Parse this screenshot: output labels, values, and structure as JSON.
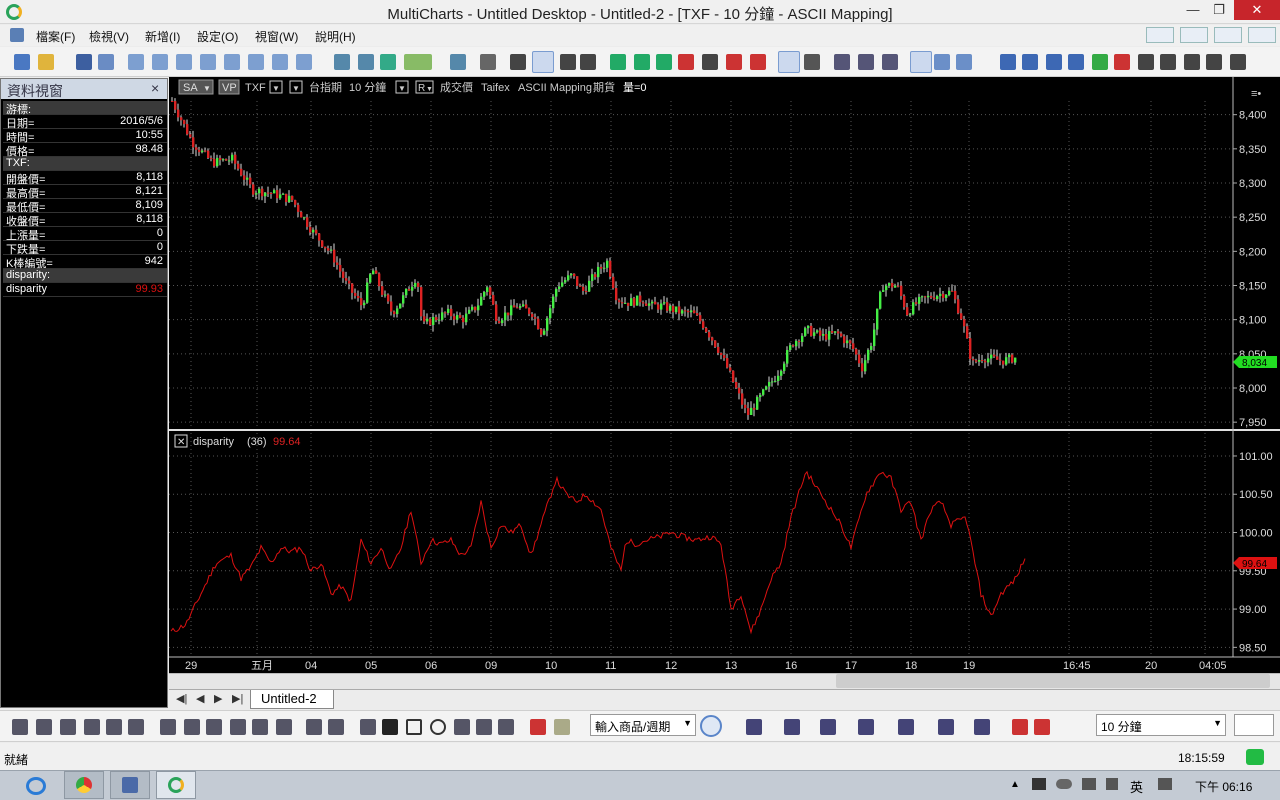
{
  "window": {
    "title": "MultiCharts - Untitled Desktop - Untitled-2 - [TXF - 10 分鐘 - ASCII Mapping]"
  },
  "menu": [
    "檔案(F)",
    "檢視(V)",
    "新增(I)",
    "設定(O)",
    "視窗(W)",
    "說明(H)"
  ],
  "dataview": {
    "title": "資料視窗",
    "rows": [
      {
        "k": "游標:",
        "v": "",
        "section": true
      },
      {
        "k": "日期=",
        "v": "2016/5/6"
      },
      {
        "k": "時間=",
        "v": "10:55"
      },
      {
        "k": "價格=",
        "v": "98.48"
      },
      {
        "k": "TXF:",
        "v": "",
        "section": true
      },
      {
        "k": "開盤價=",
        "v": "8,118"
      },
      {
        "k": "最高價=",
        "v": "8,121"
      },
      {
        "k": "最低價=",
        "v": "8,109"
      },
      {
        "k": "收盤價=",
        "v": "8,118"
      },
      {
        "k": "上漲量=",
        "v": "0"
      },
      {
        "k": "下跌量=",
        "v": "0"
      },
      {
        "k": "K棒編號=",
        "v": "942"
      },
      {
        "k": "disparity:",
        "v": "",
        "section": true
      },
      {
        "k": "disparity",
        "v": "99.93",
        "red": true
      }
    ]
  },
  "chart": {
    "header": {
      "badges": [
        "SA",
        "VP"
      ],
      "symbol": "TXF",
      "exchange": "台指期",
      "interval": "10 分鐘",
      "badge_r": "R",
      "field": "成交價",
      "source": "Taifex",
      "mapping": "ASCII Mapping",
      "category": "期貨",
      "volume": "量=0"
    },
    "indicator": {
      "name": "disparity",
      "param": "(36)",
      "value": "99.64"
    },
    "price_last": "8,034",
    "disp_last": "99.64"
  },
  "chart_data": [
    {
      "type": "candlestick",
      "yaxis": [
        "8,400",
        "8,350",
        "8,300",
        "8,250",
        "8,200",
        "8,150",
        "8,100",
        "8,050",
        "8,000",
        "7,950"
      ],
      "ylim": [
        7940,
        8420
      ],
      "path": [
        [
          0,
          8420
        ],
        [
          20,
          8360
        ],
        [
          40,
          8330
        ],
        [
          60,
          8335
        ],
        [
          80,
          8290
        ],
        [
          100,
          8285
        ],
        [
          120,
          8275
        ],
        [
          140,
          8230
        ],
        [
          160,
          8195
        ],
        [
          175,
          8150
        ],
        [
          190,
          8120
        ],
        [
          200,
          8175
        ],
        [
          210,
          8140
        ],
        [
          220,
          8110
        ],
        [
          230,
          8130
        ],
        [
          245,
          8165
        ],
        [
          250,
          8090
        ],
        [
          260,
          8100
        ],
        [
          275,
          8110
        ],
        [
          290,
          8100
        ],
        [
          305,
          8120
        ],
        [
          315,
          8150
        ],
        [
          325,
          8100
        ],
        [
          335,
          8110
        ],
        [
          345,
          8120
        ],
        [
          360,
          8110
        ],
        [
          370,
          8080
        ],
        [
          385,
          8150
        ],
        [
          400,
          8165
        ],
        [
          410,
          8140
        ],
        [
          425,
          8170
        ],
        [
          435,
          8185
        ],
        [
          445,
          8130
        ],
        [
          455,
          8125
        ],
        [
          470,
          8130
        ],
        [
          480,
          8120
        ],
        [
          490,
          8120
        ],
        [
          500,
          8115
        ],
        [
          510,
          8110
        ],
        [
          520,
          8110
        ],
        [
          530,
          8095
        ],
        [
          545,
          8060
        ],
        [
          555,
          8030
        ],
        [
          575,
          7960
        ],
        [
          590,
          7990
        ],
        [
          605,
          8020
        ],
        [
          620,
          8065
        ],
        [
          635,
          8085
        ],
        [
          650,
          8075
        ],
        [
          665,
          8080
        ],
        [
          680,
          8060
        ],
        [
          690,
          8030
        ],
        [
          700,
          8070
        ],
        [
          710,
          8150
        ],
        [
          725,
          8150
        ],
        [
          735,
          8110
        ],
        [
          745,
          8125
        ],
        [
          760,
          8135
        ],
        [
          775,
          8140
        ],
        [
          780,
          8140
        ],
        [
          790,
          8100
        ],
        [
          800,
          8035
        ],
        [
          810,
          8045
        ],
        [
          830,
          8040
        ],
        [
          845,
          8045
        ]
      ]
    },
    {
      "type": "line",
      "series_name": "disparity",
      "yaxis": [
        "101.00",
        "100.50",
        "100.00",
        "99.50",
        "99.00",
        "98.50"
      ],
      "ylim": [
        98.4,
        101.3
      ],
      "path": [
        [
          0,
          98.7
        ],
        [
          15,
          98.8
        ],
        [
          30,
          99.2
        ],
        [
          45,
          99.6
        ],
        [
          60,
          99.7
        ],
        [
          70,
          99.4
        ],
        [
          80,
          99.55
        ],
        [
          90,
          99.8
        ],
        [
          100,
          99.6
        ],
        [
          110,
          99.8
        ],
        [
          120,
          99.75
        ],
        [
          130,
          99.8
        ],
        [
          140,
          99.5
        ],
        [
          150,
          99.6
        ],
        [
          160,
          99.2
        ],
        [
          170,
          99.3
        ],
        [
          180,
          99.1
        ],
        [
          190,
          99.9
        ],
        [
          200,
          99.6
        ],
        [
          210,
          99.8
        ],
        [
          220,
          99.5
        ],
        [
          230,
          99.8
        ],
        [
          240,
          100.3
        ],
        [
          250,
          99.6
        ],
        [
          260,
          99.9
        ],
        [
          270,
          99.85
        ],
        [
          280,
          99.9
        ],
        [
          290,
          99.7
        ],
        [
          300,
          99.8
        ],
        [
          310,
          100.4
        ],
        [
          320,
          99.8
        ],
        [
          330,
          100.1
        ],
        [
          340,
          100.0
        ],
        [
          350,
          100.1
        ],
        [
          360,
          99.7
        ],
        [
          370,
          100.1
        ],
        [
          385,
          100.7
        ],
        [
          395,
          100.5
        ],
        [
          405,
          100.4
        ],
        [
          415,
          100.5
        ],
        [
          430,
          100.3
        ],
        [
          440,
          99.8
        ],
        [
          450,
          99.5
        ],
        [
          455,
          99.9
        ],
        [
          465,
          99.85
        ],
        [
          475,
          99.9
        ],
        [
          490,
          99.95
        ],
        [
          500,
          100.0
        ],
        [
          510,
          99.95
        ],
        [
          525,
          99.9
        ],
        [
          540,
          99.95
        ],
        [
          550,
          99.85
        ],
        [
          560,
          99.0
        ],
        [
          570,
          99.2
        ],
        [
          580,
          98.7
        ],
        [
          590,
          99.0
        ],
        [
          600,
          99.4
        ],
        [
          610,
          99.6
        ],
        [
          620,
          100.2
        ],
        [
          635,
          100.8
        ],
        [
          645,
          100.6
        ],
        [
          660,
          100.3
        ],
        [
          670,
          100.1
        ],
        [
          680,
          99.8
        ],
        [
          695,
          100.5
        ],
        [
          710,
          100.8
        ],
        [
          720,
          100.7
        ],
        [
          730,
          100.3
        ],
        [
          740,
          100.4
        ],
        [
          750,
          99.9
        ],
        [
          760,
          100.3
        ],
        [
          770,
          100.4
        ],
        [
          780,
          100.1
        ],
        [
          795,
          100.2
        ],
        [
          810,
          99.2
        ],
        [
          820,
          98.9
        ],
        [
          830,
          99.2
        ],
        [
          845,
          99.4
        ],
        [
          855,
          99.7
        ]
      ]
    }
  ],
  "timeaxis": [
    "29",
    "五月",
    "04",
    "05",
    "06",
    "09",
    "10",
    "11",
    "12",
    "13",
    "16",
    "17",
    "18",
    "19",
    "16:45",
    "20",
    "04:05"
  ],
  "tabs": {
    "sheet": "Untitled-2"
  },
  "toolbar2": {
    "symbol_select": "輸入商品/週期",
    "interval_select": "10 分鐘"
  },
  "status": {
    "left": "就緒",
    "clock": "18:15:59"
  },
  "taskbar": {
    "ime": "英",
    "clock": "下午 06:16"
  },
  "colors": {
    "up": "#44ee44",
    "down": "#dd2222",
    "disparity": "#dd1111",
    "last_price_bg": "#22dd22",
    "last_disp_bg": "#dd1111"
  }
}
